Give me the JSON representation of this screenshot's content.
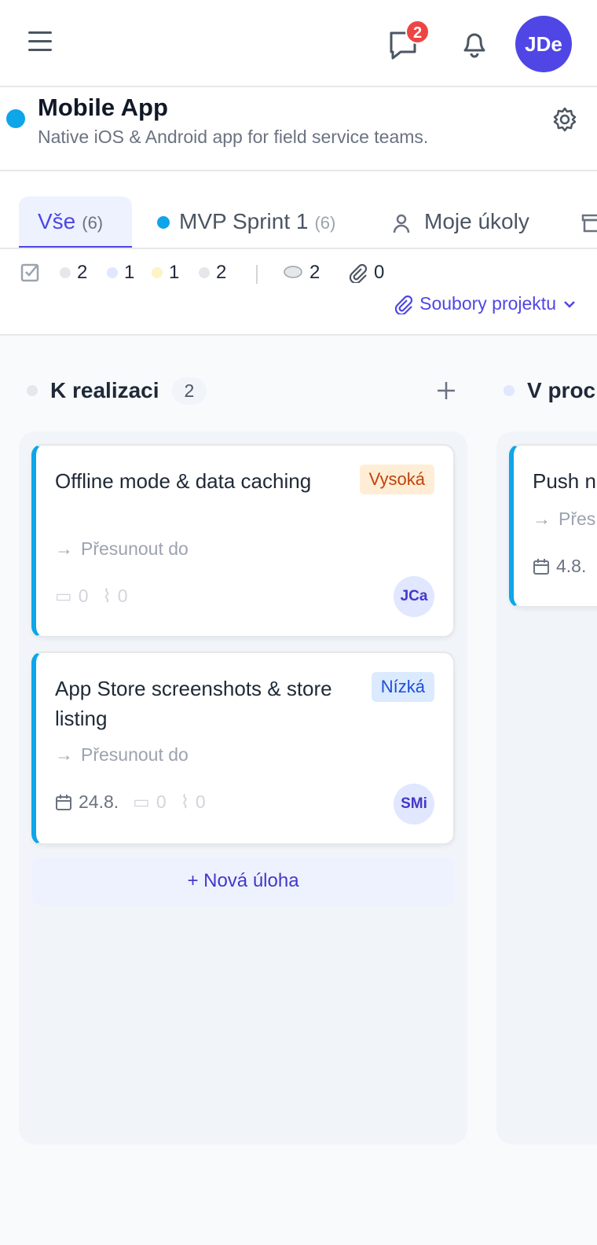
{
  "header": {
    "notifications_badge": "2",
    "avatar_initials": "JDe"
  },
  "project": {
    "title": "Mobile App",
    "description": "Native iOS & Android app for field service teams.",
    "color": "#0ea5e9"
  },
  "tabs": [
    {
      "label": "Vše",
      "count": "(6)",
      "active": true
    },
    {
      "label": "MVP Sprint 1",
      "count": "(6)"
    },
    {
      "label": "Moje úkoly"
    }
  ],
  "stats": {
    "status_counts": [
      "2",
      "1",
      "1",
      "2"
    ],
    "comments": "2",
    "attachments": "0",
    "files_link": "Soubory projektu"
  },
  "columns": [
    {
      "title": "K realizaci",
      "count": "2",
      "cards": [
        {
          "title": "Offline mode & data caching",
          "priority": "Vysoká",
          "move": "Přesunout do",
          "comments": "0",
          "attachments": "0",
          "assignee": "JCa"
        },
        {
          "title": "App Store screenshots & store listing",
          "priority": "Nízká",
          "move": "Přesunout do",
          "date": "24.8.",
          "comments": "0",
          "attachments": "0",
          "assignee": "SMi"
        }
      ],
      "new_task": "+ Nová úloha"
    },
    {
      "title": "V proc",
      "cards": [
        {
          "title": "Push n",
          "move": "Přes",
          "date": "4.8."
        }
      ]
    }
  ]
}
